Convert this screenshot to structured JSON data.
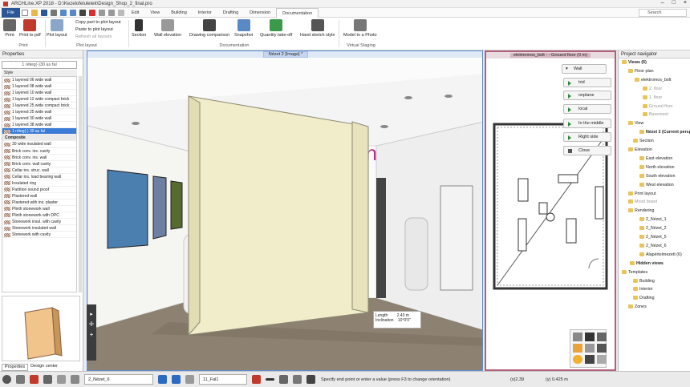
{
  "window": {
    "title": "ARCHLine.XP 2018 - D:\\Kezelofeluletek\\Design_Shop_2_final.pro"
  },
  "menu": {
    "tabs": [
      "File",
      "Edit",
      "View",
      "Building",
      "Interior",
      "Drafting",
      "Dimension",
      "Documentation"
    ],
    "active": "Documentation",
    "search_placeholder": "Search"
  },
  "ribbon": {
    "print": {
      "print": "Print",
      "print_pdf": "Print to pdf",
      "group": "Print"
    },
    "plot": {
      "plot_layout": "Plot layout",
      "copy_part": "Copy part to plot layout",
      "paste_plot": "Paste to plot layout",
      "refresh": "Refresh all layouts",
      "group": "Plot layout"
    },
    "doc": {
      "section": "Section",
      "wall_elevation": "Wall elevation",
      "drawing_comparison": "Drawing comparison",
      "snapshot": "Snapshot",
      "quantity": "Quantity take-off",
      "hand_sketch": "Hand sketch style",
      "group": "Documentation"
    },
    "staging": {
      "model_photo": "Model to a Photo",
      "group": "Virtual Staging"
    }
  },
  "properties": {
    "title": "Properties",
    "selector": "1 réteg(-)30 as fal",
    "section": "Style",
    "items": [
      {
        "label": "1 layered 06 wide wall",
        "type": "item"
      },
      {
        "label": "1 layered 08 wide wall",
        "type": "item"
      },
      {
        "label": "1 layered 10 wide wall",
        "type": "item"
      },
      {
        "label": "1 layered 12 wide compact brick",
        "type": "item"
      },
      {
        "label": "1 layered 25 wide compact brick",
        "type": "item"
      },
      {
        "label": "1 layered 25 wide wall",
        "type": "item"
      },
      {
        "label": "1 layered 30 wide wall",
        "type": "item"
      },
      {
        "label": "1 layered 38 wide wall",
        "type": "item"
      },
      {
        "label": "1 réteg(-) 30 as fal",
        "type": "sel"
      },
      {
        "label": "Composite",
        "type": "hdr"
      },
      {
        "label": "30 wide insulated wall",
        "type": "item"
      },
      {
        "label": "Brick conv. ins. cavity",
        "type": "item"
      },
      {
        "label": "Brick conv. ins. wall",
        "type": "item"
      },
      {
        "label": "Brick conv. wall cavity",
        "type": "item"
      },
      {
        "label": "Cellar ins. struc. wall",
        "type": "item"
      },
      {
        "label": "Cellar ins. load bearing wall",
        "type": "item"
      },
      {
        "label": "Insulated ring",
        "type": "item"
      },
      {
        "label": "Partition sound proof",
        "type": "item"
      },
      {
        "label": "Plastered wall",
        "type": "item"
      },
      {
        "label": "Plastered with ins. plaster",
        "type": "item"
      },
      {
        "label": "Plinth stonework wall",
        "type": "item"
      },
      {
        "label": "Plinth stonework with DPC",
        "type": "item"
      },
      {
        "label": "Stonework insul. with cavity",
        "type": "item"
      },
      {
        "label": "Stonework insulated wall",
        "type": "item"
      },
      {
        "label": "Stonework with cavity",
        "type": "item"
      }
    ],
    "tabs": [
      "Properties",
      "Design center"
    ]
  },
  "viewport": {
    "title": "Nézet 2 [Image] *",
    "sign_text": "gn",
    "length_label": "Length",
    "length_value": "2.43 m",
    "incl_label": "Inclination",
    "incl_value": "10°0'0\""
  },
  "floorplan": {
    "title": "elektromos_bolt - - Ground floor (0 m)",
    "ctx_title": "Wall",
    "ctx_items": [
      "trid",
      "onplane",
      "local",
      "In the middle",
      "Right side",
      "Close"
    ]
  },
  "navigator": {
    "title": "Project navigator",
    "items": [
      {
        "label": "Views (6)",
        "bold": true,
        "gray": false,
        "x": 4
      },
      {
        "label": "Floor plan",
        "bold": false,
        "gray": false,
        "x": 12
      },
      {
        "label": "elektromos_bolt",
        "bold": false,
        "gray": false,
        "x": 20
      },
      {
        "label": "2. floor",
        "bold": false,
        "gray": true,
        "x": 30
      },
      {
        "label": "1. floor",
        "bold": false,
        "gray": true,
        "x": 30
      },
      {
        "label": "Ground floor",
        "bold": false,
        "gray": true,
        "x": 30
      },
      {
        "label": "Basement",
        "bold": false,
        "gray": true,
        "x": 30
      },
      {
        "label": "View",
        "bold": false,
        "gray": false,
        "x": 12
      },
      {
        "label": "Nézet 2 (Current perspective)",
        "bold": true,
        "gray": false,
        "x": 26
      },
      {
        "label": "Section",
        "bold": false,
        "gray": false,
        "x": 18
      },
      {
        "label": "Elevation",
        "bold": false,
        "gray": false,
        "x": 12
      },
      {
        "label": "East elevation",
        "bold": false,
        "gray": false,
        "x": 26
      },
      {
        "label": "North elevation",
        "bold": false,
        "gray": false,
        "x": 26
      },
      {
        "label": "South elevation",
        "bold": false,
        "gray": false,
        "x": 26
      },
      {
        "label": "West elevation",
        "bold": false,
        "gray": false,
        "x": 26
      },
      {
        "label": "Print layout",
        "bold": false,
        "gray": false,
        "x": 12
      },
      {
        "label": "Mood board",
        "bold": false,
        "gray": true,
        "x": 12
      },
      {
        "label": "Rendering",
        "bold": false,
        "gray": false,
        "x": 12
      },
      {
        "label": "2_Nézet_1",
        "bold": false,
        "gray": false,
        "x": 26
      },
      {
        "label": "2_Nézet_2",
        "bold": false,
        "gray": false,
        "x": 26
      },
      {
        "label": "2_Nézet_5",
        "bold": false,
        "gray": false,
        "x": 26
      },
      {
        "label": "2_Nézet_6",
        "bold": false,
        "gray": false,
        "x": 26
      },
      {
        "label": "Alapértelmezett (6)",
        "bold": false,
        "gray": false,
        "x": 26
      },
      {
        "label": "Hidden views",
        "bold": true,
        "gray": false,
        "x": 14
      },
      {
        "label": "Templates",
        "bold": false,
        "gray": false,
        "x": 4
      },
      {
        "label": "Building",
        "bold": false,
        "gray": false,
        "x": 18
      },
      {
        "label": "Interior",
        "bold": false,
        "gray": false,
        "x": 18
      },
      {
        "label": "Drafting",
        "bold": false,
        "gray": false,
        "x": 18
      },
      {
        "label": "Zones",
        "bold": false,
        "gray": false,
        "x": 12
      }
    ]
  },
  "status": {
    "view_combo": "2_Nézet_6",
    "layer_combo": "11_Fal1",
    "message": "Specify end point or enter a value (press F3 to change orientation)",
    "x_coord": "(x)2.39",
    "y_coord": "(y) 0.425 m"
  }
}
